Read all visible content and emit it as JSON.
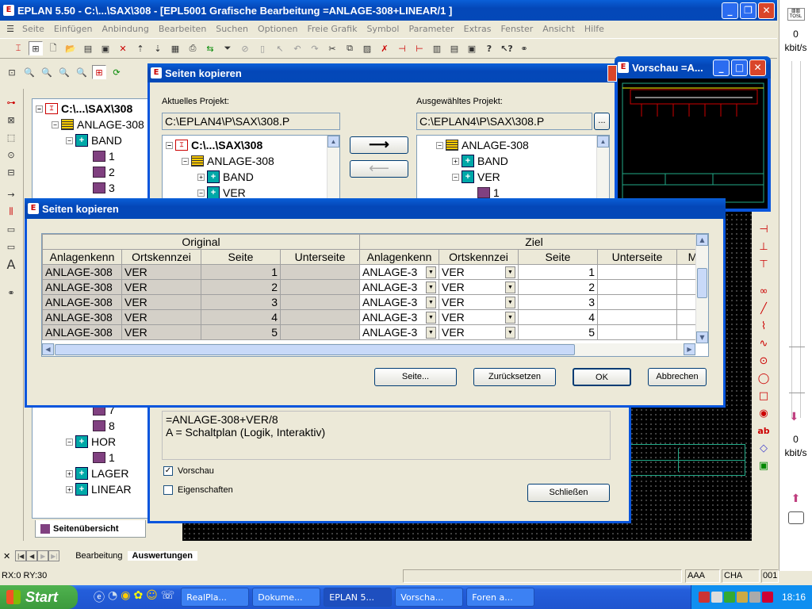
{
  "app": {
    "title": "EPLAN 5.50 - C:\\...\\SAX\\308 - [EPL5001 Grafische Bearbeitung =ANLAGE-308+LINEAR/1   ]",
    "menu": [
      "Seite",
      "Einfügen",
      "Anbindung",
      "Bearbeiten",
      "Suchen",
      "Optionen",
      "Freie Grafik",
      "Symbol",
      "Parameter",
      "Extras",
      "Fenster",
      "Ansicht",
      "Hilfe"
    ]
  },
  "left_tree": {
    "items": [
      "C:\\...\\SAX\\308",
      "ANLAGE-308",
      "BAND",
      "1",
      "2",
      "3"
    ],
    "lower_items": [
      "7",
      "8",
      "HOR",
      "1",
      "LAGER",
      "LINEAR"
    ],
    "tab_label": "Seitenübersicht"
  },
  "copy_dialog": {
    "title": "Seiten kopieren",
    "current_project_label": "Aktuelles Projekt:",
    "current_project_value": "C:\\EPLAN4\\P\\SAX\\308.P",
    "selected_project_label": "Ausgewähltes Projekt:",
    "selected_project_value": "C:\\EPLAN4\\P\\SAX\\308.P",
    "browse_label": "...",
    "arrow_right": "⟶",
    "arrow_left": "⟵",
    "src_tree": [
      "C:\\...\\SAX\\308",
      "ANLAGE-308",
      "BAND",
      "VER"
    ],
    "dst_tree": [
      "ANLAGE-308",
      "BAND",
      "VER",
      "1"
    ],
    "info_line1": "=ANLAGE-308+VER/8",
    "info_line2": "A = Schaltplan  (Logik, Interaktiv)",
    "preview_label": "Vorschau",
    "properties_label": "Eigenschaften",
    "close_label": "Schließen"
  },
  "inner_dialog": {
    "title": "Seiten kopieren",
    "group_original": "Original",
    "group_target": "Ziel",
    "columns": [
      "Anlagenkenn",
      "Ortskennzei",
      "Seite",
      "Unterseite",
      "Anlagenkenn",
      "Ortskennzei",
      "Seite",
      "Unterseite",
      "M"
    ],
    "rows": [
      {
        "o_anl": "ANLAGE-308",
        "o_ort": "VER",
        "o_seite": "1",
        "o_unter": "",
        "z_anl": "ANLAGE-3",
        "z_ort": "VER",
        "z_seite": "1",
        "z_unter": ""
      },
      {
        "o_anl": "ANLAGE-308",
        "o_ort": "VER",
        "o_seite": "2",
        "o_unter": "",
        "z_anl": "ANLAGE-3",
        "z_ort": "VER",
        "z_seite": "2",
        "z_unter": ""
      },
      {
        "o_anl": "ANLAGE-308",
        "o_ort": "VER",
        "o_seite": "3",
        "o_unter": "",
        "z_anl": "ANLAGE-3",
        "z_ort": "VER",
        "z_seite": "3",
        "z_unter": ""
      },
      {
        "o_anl": "ANLAGE-308",
        "o_ort": "VER",
        "o_seite": "4",
        "o_unter": "",
        "z_anl": "ANLAGE-3",
        "z_ort": "VER",
        "z_seite": "4",
        "z_unter": ""
      },
      {
        "o_anl": "ANLAGE-308",
        "o_ort": "VER",
        "o_seite": "5",
        "o_unter": "",
        "z_anl": "ANLAGE-3",
        "z_ort": "VER",
        "z_seite": "5",
        "z_unter": ""
      }
    ],
    "buttons": {
      "page": "Seite...",
      "reset": "Zurücksetzen",
      "ok": "OK",
      "cancel": "Abbrechen"
    }
  },
  "preview_window": {
    "title": "Vorschau =A..."
  },
  "tabs": {
    "bearbeitung": "Bearbeitung",
    "auswertungen": "Auswertungen"
  },
  "status": {
    "coords": "RX:0 RY:30",
    "aaa": "AAA",
    "cha": "CHA",
    "num": "001"
  },
  "net_meter": {
    "label_top": "0",
    "unit_top": "kbit/s",
    "label_bottom": "0",
    "unit_bottom": "kbit/s"
  },
  "taskbar": {
    "start": "Start",
    "tasks": [
      "RealPla...",
      "Dokume...",
      "EPLAN 5...",
      "Vorscha...",
      "Foren a..."
    ],
    "clock": "18:16"
  },
  "colors": {
    "title_blue": "#0349b8",
    "canvas_bg": "#000000",
    "taskbar_blue": "#245edb",
    "start_green": "#3c9a3c"
  }
}
